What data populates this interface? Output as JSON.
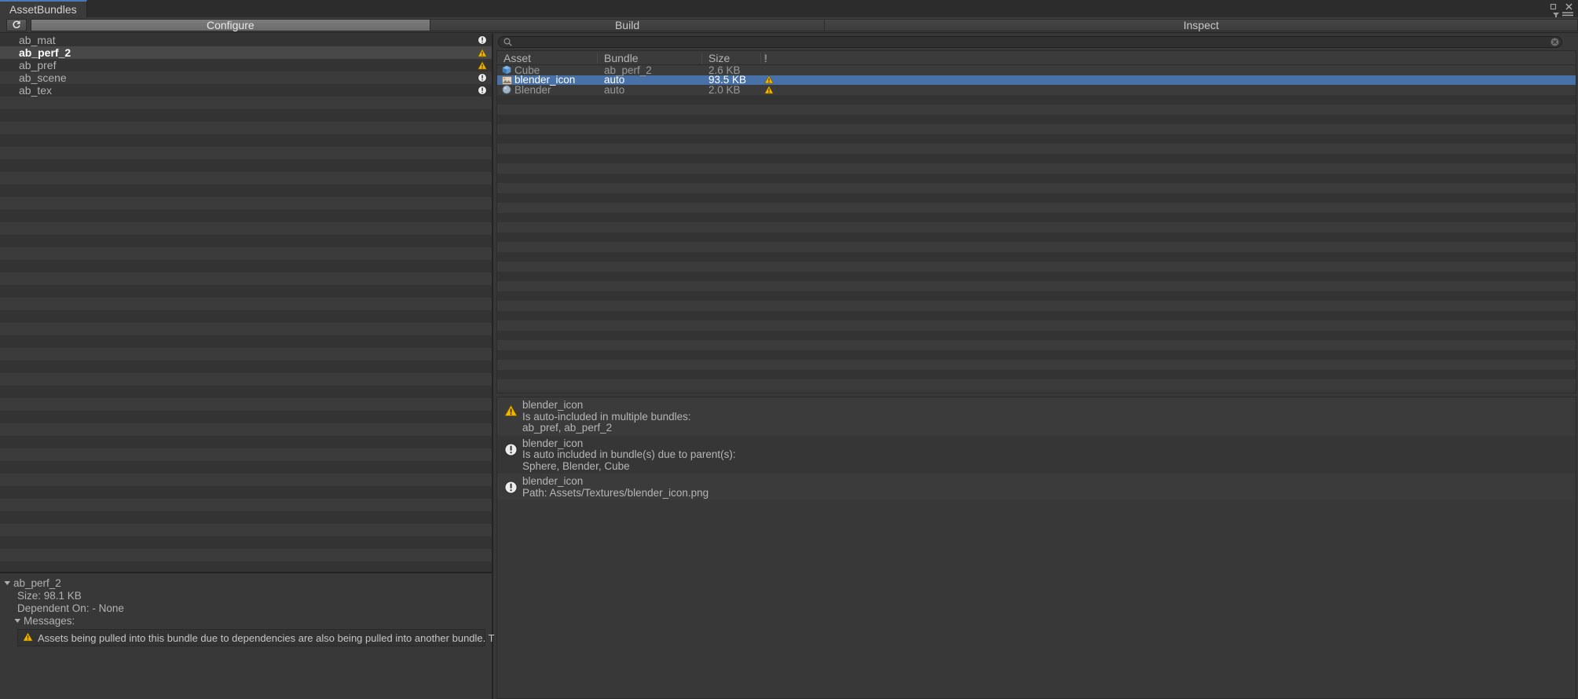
{
  "window": {
    "tab_label": "AssetBundles",
    "controls": {
      "maximize": "maximize-icon",
      "close": "close-icon",
      "filter": "filter-icon",
      "menu": "hamburger-menu-icon"
    }
  },
  "toolbar": {
    "refresh_label": "↻",
    "modes": [
      {
        "label": "Configure",
        "selected": true
      },
      {
        "label": "Build",
        "selected": false
      },
      {
        "label": "Inspect",
        "selected": false
      }
    ]
  },
  "bundle_tree": {
    "items": [
      {
        "label": "ab_mat",
        "status": "info",
        "selected": false
      },
      {
        "label": "ab_perf_2",
        "status": "warning",
        "selected": true
      },
      {
        "label": "ab_pref",
        "status": "warning",
        "selected": false
      },
      {
        "label": "ab_scene",
        "status": "info",
        "selected": false
      },
      {
        "label": "ab_tex",
        "status": "info",
        "selected": false
      }
    ]
  },
  "bundle_detail": {
    "name": "ab_perf_2",
    "size_line": "Size: 98.1 KB",
    "dependent_line": "Dependent On: - None",
    "messages_label": "Messages:",
    "message_text": "Assets being pulled into this bundle due to dependencies are also being pulled into another bundle.  This will cause duplication in memory",
    "message_icon": "warning"
  },
  "search": {
    "value": "",
    "placeholder": "",
    "icon": "search-icon",
    "clear_icon": "clear-icon"
  },
  "asset_table": {
    "columns": [
      "Asset",
      "Bundle",
      "Size",
      "!"
    ],
    "rows": [
      {
        "name": "Cube",
        "bundle": "ab_perf_2",
        "size": "2.6 KB",
        "icon": "cube-icon",
        "flag": "none",
        "selected": false
      },
      {
        "name": "blender_icon",
        "bundle": "auto",
        "size": "93.5 KB",
        "icon": "image-icon",
        "flag": "warning",
        "selected": true
      },
      {
        "name": "Blender",
        "bundle": "auto",
        "size": "2.0 KB",
        "icon": "sphere-icon",
        "flag": "warning",
        "selected": false
      }
    ]
  },
  "messages": [
    {
      "icon": "warning",
      "title": "blender_icon",
      "lines": [
        "Is auto-included in multiple bundles:",
        "ab_pref, ab_perf_2"
      ]
    },
    {
      "icon": "info",
      "title": "blender_icon",
      "lines": [
        "Is auto included in bundle(s) due to parent(s):",
        "Sphere, Blender, Cube"
      ]
    },
    {
      "icon": "info",
      "title": "blender_icon",
      "lines": [
        "Path: Assets/Textures/blender_icon.png"
      ]
    }
  ],
  "colors": {
    "background": "#383838",
    "panel": "#3b3b3b",
    "selection": "#4871a8",
    "tab_accent": "#4a78b8",
    "warning": "#f2b600",
    "info": "#e6e6e6"
  }
}
